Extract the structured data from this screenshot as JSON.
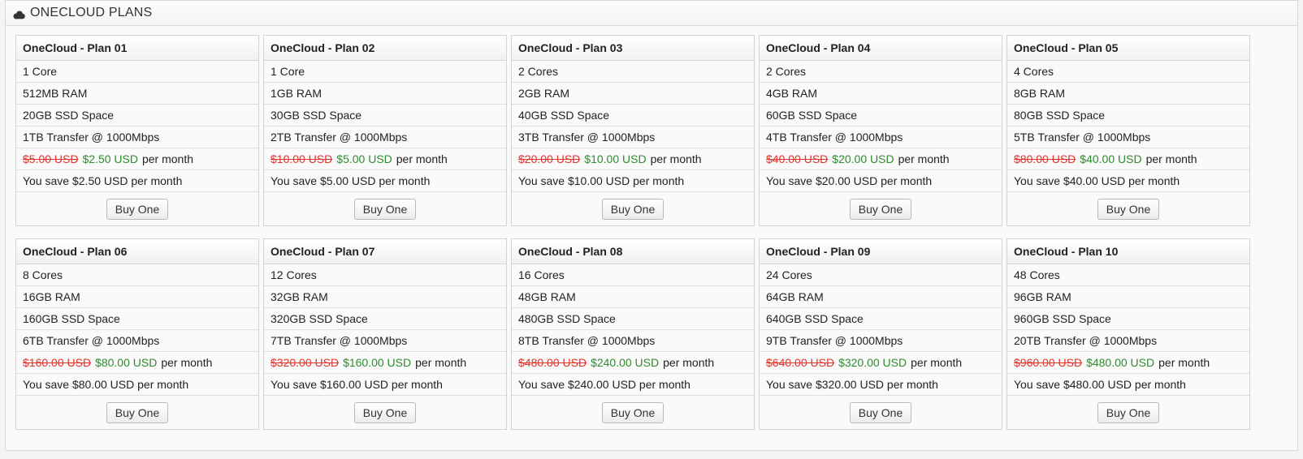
{
  "header": {
    "title": "ONECLOUD PLANS",
    "icon": "cloud-icon"
  },
  "buy_label": "Buy One",
  "price_suffix": "per month",
  "plans": [
    {
      "name": "OneCloud - Plan 01",
      "cores": "1 Core",
      "ram": "512MB RAM",
      "disk": "20GB SSD Space",
      "transfer": "1TB Transfer @ 1000Mbps",
      "old_price": "$5.00 USD",
      "new_price": "$2.50 USD",
      "save": "You save $2.50 USD per month"
    },
    {
      "name": "OneCloud - Plan 02",
      "cores": "1 Core",
      "ram": "1GB RAM",
      "disk": "30GB SSD Space",
      "transfer": "2TB Transfer @ 1000Mbps",
      "old_price": "$10.00 USD",
      "new_price": "$5.00 USD",
      "save": "You save $5.00 USD per month"
    },
    {
      "name": "OneCloud - Plan 03",
      "cores": "2 Cores",
      "ram": "2GB RAM",
      "disk": "40GB SSD Space",
      "transfer": "3TB Transfer @ 1000Mbps",
      "old_price": "$20.00 USD",
      "new_price": "$10.00 USD",
      "save": "You save $10.00 USD per month"
    },
    {
      "name": "OneCloud - Plan 04",
      "cores": "2 Cores",
      "ram": "4GB RAM",
      "disk": "60GB SSD Space",
      "transfer": "4TB Transfer @ 1000Mbps",
      "old_price": "$40.00 USD",
      "new_price": "$20.00 USD",
      "save": "You save $20.00 USD per month"
    },
    {
      "name": "OneCloud - Plan 05",
      "cores": "4 Cores",
      "ram": "8GB RAM",
      "disk": "80GB SSD Space",
      "transfer": "5TB Transfer @ 1000Mbps",
      "old_price": "$80.00 USD",
      "new_price": "$40.00 USD",
      "save": "You save $40.00 USD per month"
    },
    {
      "name": "OneCloud - Plan 06",
      "cores": "8 Cores",
      "ram": "16GB RAM",
      "disk": "160GB SSD Space",
      "transfer": "6TB Transfer @ 1000Mbps",
      "old_price": "$160.00 USD",
      "new_price": "$80.00 USD",
      "save": "You save $80.00 USD per month"
    },
    {
      "name": "OneCloud - Plan 07",
      "cores": "12 Cores",
      "ram": "32GB RAM",
      "disk": "320GB SSD Space",
      "transfer": "7TB Transfer @ 1000Mbps",
      "old_price": "$320.00 USD",
      "new_price": "$160.00 USD",
      "save": "You save $160.00 USD per month"
    },
    {
      "name": "OneCloud - Plan 08",
      "cores": "16 Cores",
      "ram": "48GB RAM",
      "disk": "480GB SSD Space",
      "transfer": "8TB Transfer @ 1000Mbps",
      "old_price": "$480.00 USD",
      "new_price": "$240.00 USD",
      "save": "You save $240.00 USD per month"
    },
    {
      "name": "OneCloud - Plan 09",
      "cores": "24 Cores",
      "ram": "64GB RAM",
      "disk": "640GB SSD Space",
      "transfer": "9TB Transfer @ 1000Mbps",
      "old_price": "$640.00 USD",
      "new_price": "$320.00 USD",
      "save": "You save $320.00 USD per month"
    },
    {
      "name": "OneCloud - Plan 10",
      "cores": "48 Cores",
      "ram": "96GB RAM",
      "disk": "960GB SSD Space",
      "transfer": "20TB Transfer @ 1000Mbps",
      "old_price": "$960.00 USD",
      "new_price": "$480.00 USD",
      "save": "You save $480.00 USD per month"
    }
  ]
}
